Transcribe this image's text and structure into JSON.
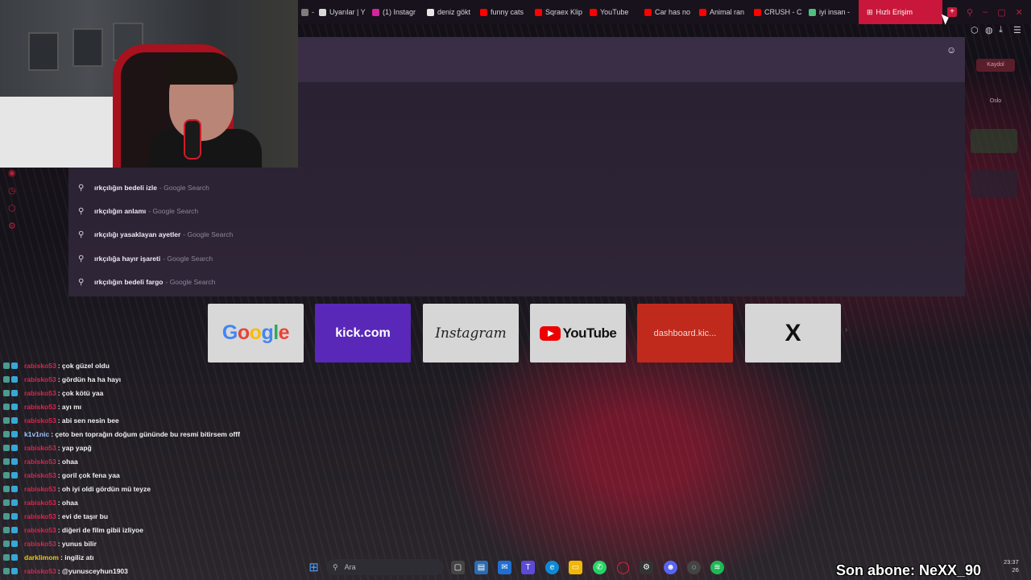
{
  "colors": {
    "accent": "#c8173a",
    "kick": "#5928b8",
    "dashboard": "#c02a1c",
    "chat_name": "#e0234d",
    "chat_name_alt": "#9ec7ff"
  },
  "tabs": [
    {
      "label": "- P",
      "icon_color": "#7d7d7d"
    },
    {
      "label": "Uyarılar | Y",
      "icon_color": "#d8d8d8"
    },
    {
      "label": "(1) Instagr",
      "icon_color": "#d6249f"
    },
    {
      "label": "deniz gökt",
      "icon_color": "#e6e6e6"
    },
    {
      "label": "funny cats",
      "icon_color": "#ff0000"
    },
    {
      "label": "Sqraex Klip",
      "icon_color": "#ff0000"
    },
    {
      "label": "YouTube",
      "icon_color": "#ff0000"
    },
    {
      "label": "Car has no",
      "icon_color": "#ff0000"
    },
    {
      "label": "Animal ran",
      "icon_color": "#ff0000"
    },
    {
      "label": "CRUSH - C",
      "icon_color": "#ff0000"
    },
    {
      "label": "iyi insan -",
      "icon_color": "#4fbe7f"
    }
  ],
  "active_tab": {
    "label": "Hızlı Erişim"
  },
  "new_tab": "+",
  "suggestions": [
    {
      "query": "ırkçılığın bedeli izle",
      "source": "- Google Search"
    },
    {
      "query": "ırkçılığın anlamı",
      "source": "- Google Search"
    },
    {
      "query": "ırkçılığı yasaklayan ayetler",
      "source": "- Google Search"
    },
    {
      "query": "ırkçılığa hayır işareti",
      "source": "- Google Search"
    },
    {
      "query": "ırkçılığın bedeli fargo",
      "source": "- Google Search"
    }
  ],
  "speed_dial": [
    {
      "id": "google",
      "label": "Google"
    },
    {
      "id": "kick",
      "label": "kick.com"
    },
    {
      "id": "instagram",
      "label": "Instagram"
    },
    {
      "id": "youtube",
      "label": "YouTube"
    },
    {
      "id": "dashboard",
      "label": "dashboard.kic..."
    },
    {
      "id": "x",
      "label": "X"
    }
  ],
  "sidebar_right": {
    "badge1": "Kaydol",
    "badge2": "Oslo"
  },
  "chat": [
    {
      "user": "rabisko53",
      "msg": ": çok güzel oldu"
    },
    {
      "user": "rabisko53",
      "msg": ": gördün ha ha hayı"
    },
    {
      "user": "rabisko53",
      "msg": ": çok kötü yaa"
    },
    {
      "user": "rabisko53",
      "msg": ": ayı mı"
    },
    {
      "user": "rabisko53",
      "msg": ": abi sen nesin bee"
    },
    {
      "user": "k1v1nic",
      "msg": ": çeto ben toprağın doğum gününde bu resmi bitirsem offf"
    },
    {
      "user": "rabisko53",
      "msg": ": yap yapğ"
    },
    {
      "user": "rabisko53",
      "msg": ": ohaa"
    },
    {
      "user": "rabisko53",
      "msg": ": goril çok fena yaa"
    },
    {
      "user": "rabisko53",
      "msg": ": oh iyi oldi gördün mü teyze"
    },
    {
      "user": "rabisko53",
      "msg": ": ohaa"
    },
    {
      "user": "rabisko53",
      "msg": ": evi de taşır bu"
    },
    {
      "user": "rabisko53",
      "msg": ": diğeri de film gibii izliyoe"
    },
    {
      "user": "rabisko53",
      "msg": ": yunus bilir"
    },
    {
      "user": "darklimom",
      "msg": ": ingiliz atı"
    },
    {
      "user": "rabisko53",
      "msg": ": @yunusceyhun1903"
    }
  ],
  "taskbar": {
    "search_placeholder": "Ara",
    "time": "23:37",
    "date": "26"
  },
  "subscriber_banner": "Son abone: NeXX_90"
}
